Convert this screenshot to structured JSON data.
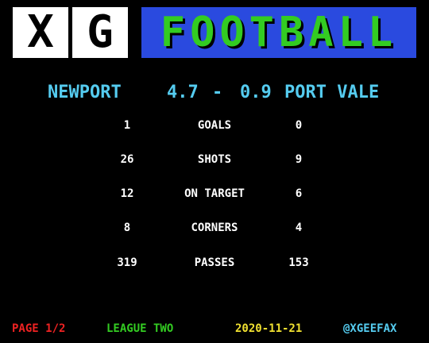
{
  "header": {
    "logo_letters": [
      "X",
      "G"
    ],
    "title": "FOOTBALL",
    "colors": {
      "logo_bg": "#ffffff",
      "title_bg": "#2a4adf",
      "title_text": "#33cc22"
    }
  },
  "match": {
    "home_team": "NEWPORT",
    "home_xg": "4.7",
    "separator": "-",
    "away_xg": "0.9",
    "away_team": "PORT VALE"
  },
  "stats": [
    {
      "label": "GOALS",
      "home": "1",
      "away": "0"
    },
    {
      "label": "SHOTS",
      "home": "26",
      "away": "9"
    },
    {
      "label": "ON TARGET",
      "home": "12",
      "away": "6"
    },
    {
      "label": "CORNERS",
      "home": "8",
      "away": "4"
    },
    {
      "label": "PASSES",
      "home": "319",
      "away": "153"
    }
  ],
  "footer": {
    "page": "PAGE 1/2",
    "league": "LEAGUE TWO",
    "date": "2020-11-21",
    "handle": "@XGEEFAX",
    "colors": {
      "page": "#ee2222",
      "league": "#33cc22",
      "date": "#f0e030",
      "handle": "#55ccf0"
    }
  }
}
